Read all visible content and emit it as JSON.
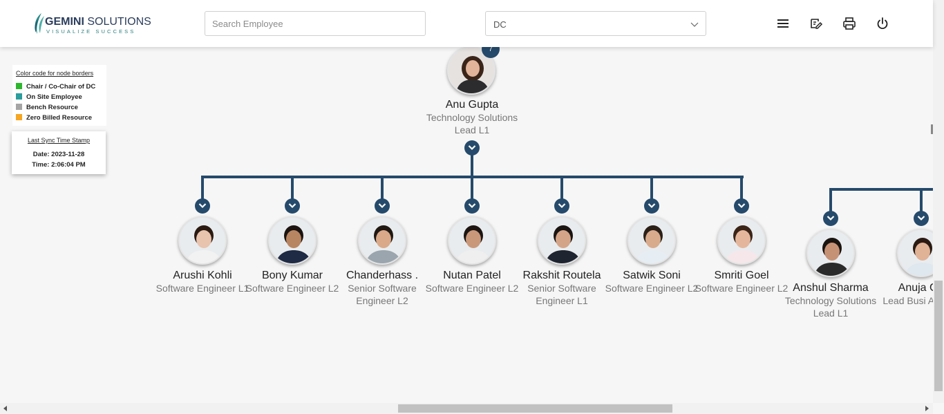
{
  "header": {
    "logo_name_bold": "GEMINI",
    "logo_name_rest": " SOLUTIONS",
    "logo_tagline": "VISUALIZE SUCCESS",
    "search_placeholder": "Search Employee",
    "select_value": "DC"
  },
  "legend": {
    "title": "Color code for node borders",
    "items": [
      {
        "label": "Chair / Co-Chair of DC",
        "color": "#2db82d"
      },
      {
        "label": "On Site Employee",
        "color": "#2a9d9d"
      },
      {
        "label": "Bench Resource",
        "color": "#a5a5a5"
      },
      {
        "label": "Zero Billed Resource",
        "color": "#f5a623"
      }
    ]
  },
  "sync": {
    "title": "Last Sync Time Stamp",
    "date": "Date: 2023-11-28",
    "time": "Time: 2:06:04 PM"
  },
  "root": {
    "name": "Anu Gupta",
    "title": "Technology Solutions Lead L1",
    "badge": "7"
  },
  "children": [
    {
      "name": "Arushi Kohli",
      "title": "Software Engineer L1",
      "skin": "#e8c3ad",
      "hair": "#2a1a12",
      "shirt": "#f2f2f2"
    },
    {
      "name": "Bony Kumar",
      "title": "Software Engineer L2",
      "skin": "#b88562",
      "hair": "#1b1410",
      "shirt": "#1f2a44"
    },
    {
      "name": "Chanderhass .",
      "title": "Senior Software Engineer L2",
      "skin": "#d9a989",
      "hair": "#201812",
      "shirt": "#9aa5ad"
    },
    {
      "name": "Nutan Patel",
      "title": "Software Engineer L2",
      "skin": "#c9987a",
      "hair": "#1c1512",
      "shirt": "#efefef"
    },
    {
      "name": "Rakshit Routela",
      "title": "Senior Software Engineer L1",
      "skin": "#d4a488",
      "hair": "#1a1412",
      "shirt": "#1e2430"
    },
    {
      "name": "Satwik Soni",
      "title": "Software Engineer L2",
      "skin": "#d8ab8d",
      "hair": "#2b2018",
      "shirt": "#e6eef4"
    },
    {
      "name": "Smriti Goel",
      "title": "Software Engineer L2",
      "skin": "#e4b79c",
      "hair": "#3a2418",
      "shirt": "#f6e7ea"
    }
  ],
  "side_group": [
    {
      "name": "Anshul Sharma",
      "title": "Technology Solutions Lead L1",
      "skin": "#c69276",
      "hair": "#1a1410",
      "shirt": "#2a2a2a"
    },
    {
      "name": "Anuja Gu",
      "title": "Lead Busi Analyst",
      "skin": "#e0b296",
      "hair": "#2a1a12",
      "shirt": "#dfe8ef"
    }
  ],
  "colors": {
    "connector": "#254a6b",
    "background": "#f6f6f6"
  }
}
